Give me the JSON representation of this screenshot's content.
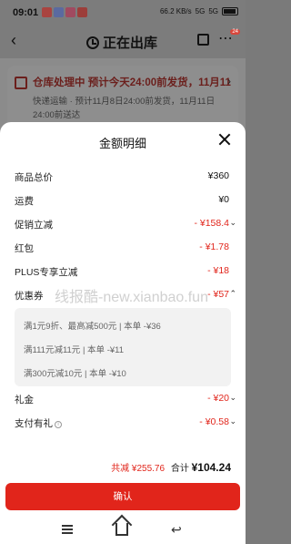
{
  "status_bar": {
    "time": "09:01",
    "net": "66.2 KB/s",
    "network": "5G",
    "signal": "5G"
  },
  "top_nav": {
    "title": "正在出库",
    "badge": "24"
  },
  "order_card": {
    "status": "仓库处理中  预计今天24:00前发货，11月11",
    "detail": "快递运输 · 预计11月8日24:00前发货，11月11日24:00前送达"
  },
  "sheet": {
    "title": "金额明细",
    "rows": [
      {
        "label": "商品总价",
        "value": "¥360",
        "style": "black"
      },
      {
        "label": "运费",
        "value": "¥0",
        "style": "black"
      },
      {
        "label": "促销立减",
        "value": "- ¥158.4",
        "style": "red",
        "chevron": "⌄"
      },
      {
        "label": "红包",
        "value": "- ¥1.78",
        "style": "red"
      },
      {
        "label": "PLUS专享立减",
        "value": "- ¥18",
        "style": "red"
      },
      {
        "label": "优惠券",
        "value": "- ¥57",
        "style": "red",
        "chevron": "⌃"
      }
    ],
    "coupons": [
      "满1元9折、最高减500元 | 本单 -¥36",
      "满111元减11元 | 本单 -¥11",
      "满300元减10元 | 本单 -¥10"
    ],
    "rows_after": [
      {
        "label": "礼金",
        "value": "- ¥20",
        "style": "red",
        "chevron": "⌄"
      },
      {
        "label": "支付有礼",
        "value": "- ¥0.58",
        "style": "red",
        "chevron": "⌄",
        "info": "i"
      }
    ],
    "watermark": "线报酷-new.xianbao.fun",
    "summary": {
      "reduce": "共减 ¥255.76",
      "total_label": "合计",
      "total": "¥104.24"
    },
    "confirm_label": "确认"
  },
  "colors": {
    "accent": "#e1251b",
    "sheet_bg": "#ffffff",
    "overlay": "#8b8b8b"
  }
}
